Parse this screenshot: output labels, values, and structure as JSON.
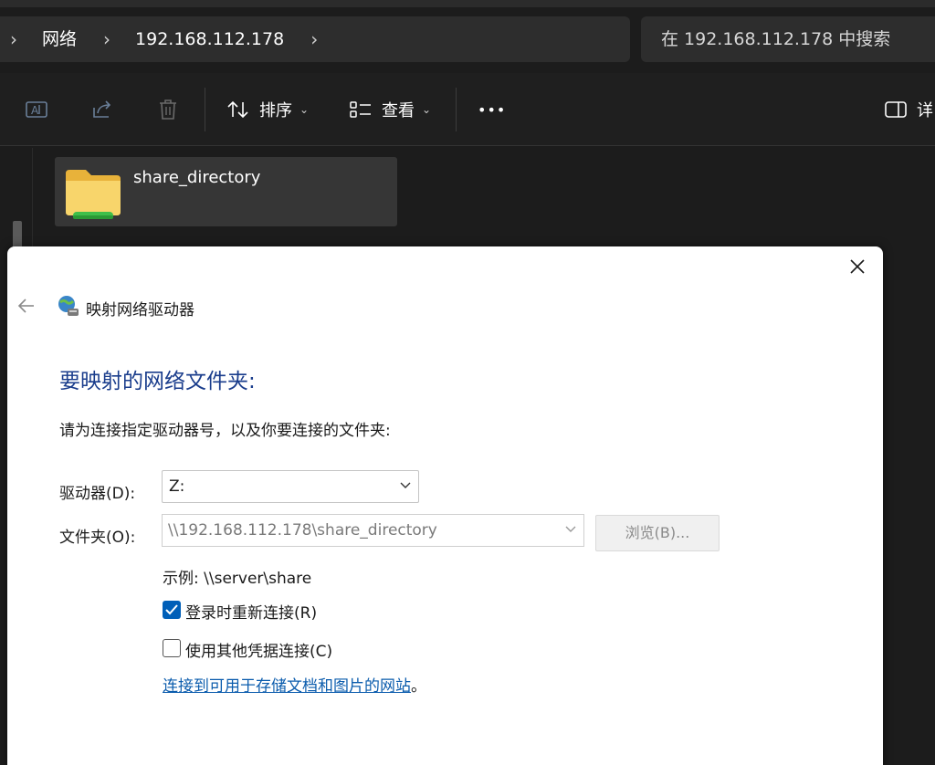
{
  "address_bar": {
    "crumbs": [
      "网络",
      "192.168.112.178"
    ],
    "search_placeholder": "在 192.168.112.178 中搜索"
  },
  "toolbar": {
    "sort_label": "排序",
    "view_label": "查看",
    "more_label": "•••",
    "details_label": "详"
  },
  "content": {
    "folder_name": "share_directory"
  },
  "dialog": {
    "title": "映射网络驱动器",
    "heading": "要映射的网络文件夹:",
    "instruction": "请为连接指定驱动器号，以及你要连接的文件夹:",
    "drive_label": "驱动器(D):",
    "drive_value": "Z:",
    "folder_label": "文件夹(O):",
    "folder_value": "\\\\192.168.112.178\\share_directory",
    "browse_label": "浏览(B)...",
    "example": "示例: \\\\server\\share",
    "reconnect_label": "登录时重新连接(R)",
    "reconnect_checked": true,
    "other_creds_label": "使用其他凭据连接(C)",
    "other_creds_checked": false,
    "link_text": "连接到可用于存储文档和图片的网站",
    "link_suffix": "。"
  },
  "colors": {
    "heading": "#1a3d8c",
    "link": "#0b5cad",
    "checkbox_accent": "#005fb8",
    "folder_yellow": "#f5c842",
    "share_green": "#3fbf4a"
  }
}
